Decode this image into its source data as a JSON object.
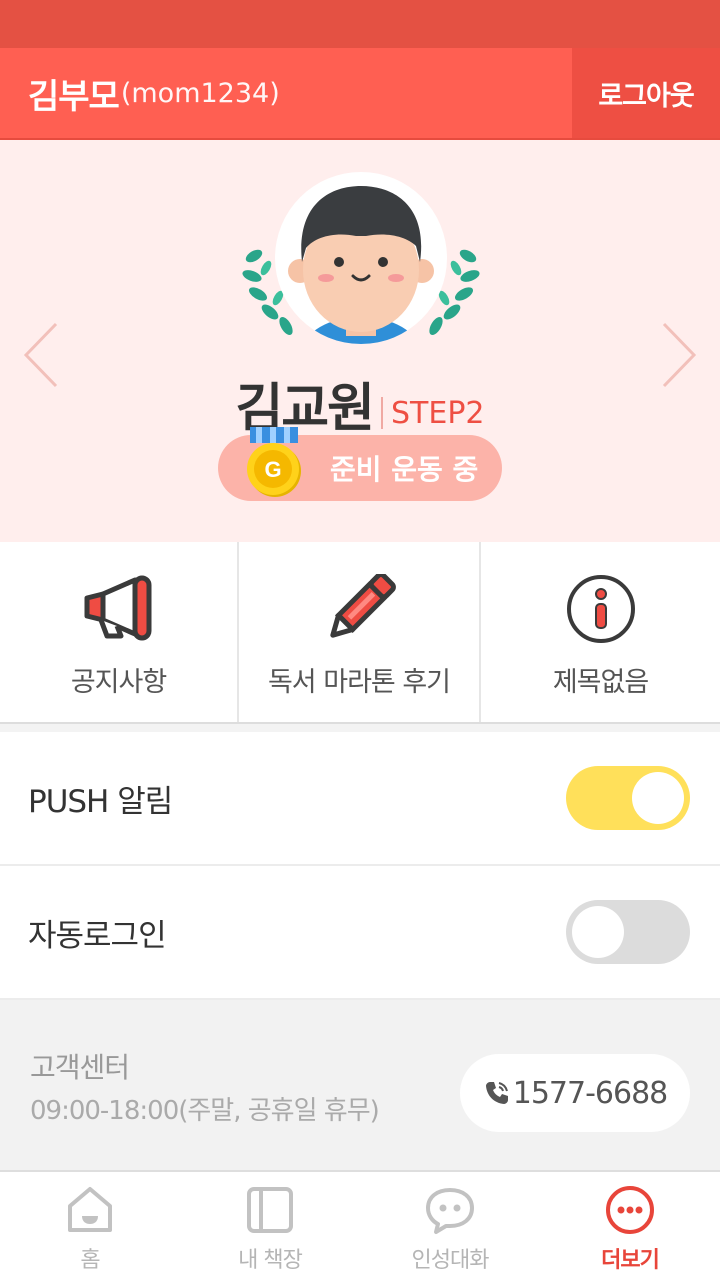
{
  "header": {
    "user_name": "김부모",
    "user_id": "(mom1234)",
    "logout_label": "로그아웃"
  },
  "profile": {
    "child_name": "김교원",
    "step": "STEP2",
    "medal_letter": "G",
    "badge_label": "준비 운동 중"
  },
  "menu": [
    {
      "label": "공지사항",
      "icon": "megaphone-icon"
    },
    {
      "label": "독서 마라톤 후기",
      "icon": "pencil-icon"
    },
    {
      "label": "제목없음",
      "icon": "info-icon"
    }
  ],
  "settings": [
    {
      "label": "PUSH 알림",
      "enabled": true
    },
    {
      "label": "자동로그인",
      "enabled": false
    }
  ],
  "customer_center": {
    "title": "고객센터",
    "hours": "09:00-18:00(주말, 공휴일 휴무)",
    "phone": "1577-6688"
  },
  "tabs": [
    {
      "label": "홈",
      "icon": "home-icon"
    },
    {
      "label": "내 책장",
      "icon": "bookshelf-icon"
    },
    {
      "label": "인성대화",
      "icon": "chat-icon"
    },
    {
      "label": "더보기",
      "icon": "more-icon",
      "active": true
    }
  ],
  "colors": {
    "brand_red": "#ff5f52",
    "toggle_on": "#ffe05a",
    "active_tab": "#e8453a"
  }
}
